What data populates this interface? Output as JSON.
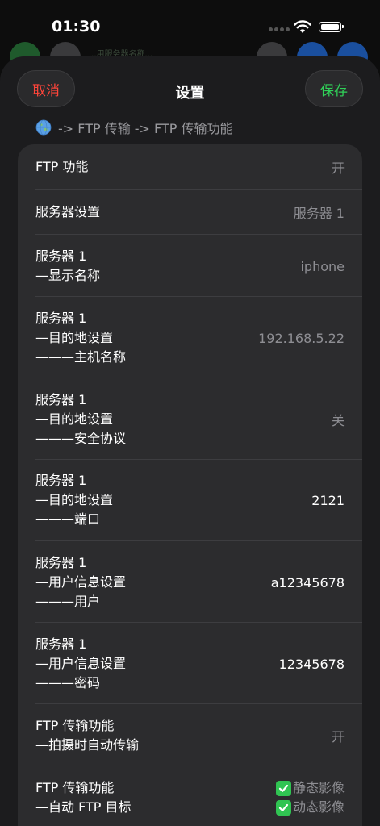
{
  "status_bar": {
    "time": "01:30"
  },
  "background_app": {
    "snippet": "...用服务器名称..."
  },
  "nav": {
    "cancel": "取消",
    "title": "设置",
    "save": "保存"
  },
  "breadcrumb": "-> FTP 传输 -> FTP 传输功能",
  "rows": [
    {
      "lines": [
        "FTP 功能"
      ],
      "value": "开",
      "value_style": "dim"
    },
    {
      "lines": [
        "服务器设置"
      ],
      "value": "服务器 1",
      "value_style": "dim"
    },
    {
      "lines": [
        "服务器 1",
        "—显示名称"
      ],
      "value": "iphone",
      "value_style": "dim"
    },
    {
      "lines": [
        "服务器 1",
        "—目的地设置",
        "———主机名称"
      ],
      "value": "192.168.5.22",
      "value_style": "dim"
    },
    {
      "lines": [
        "服务器 1",
        "—目的地设置",
        "———安全协议"
      ],
      "value": "关",
      "value_style": "dim"
    },
    {
      "lines": [
        "服务器 1",
        "—目的地设置",
        "———端口"
      ],
      "value": "2121",
      "value_style": "bright"
    },
    {
      "lines": [
        "服务器 1",
        "—用户信息设置",
        "———用户"
      ],
      "value": "a12345678",
      "value_style": "bright"
    },
    {
      "lines": [
        "服务器 1",
        "—用户信息设置",
        "———密码"
      ],
      "value": "12345678",
      "value_style": "bright"
    },
    {
      "lines": [
        "FTP 传输功能",
        "—拍摄时自动传输"
      ],
      "value": "开",
      "value_style": "dim"
    },
    {
      "lines": [
        "FTP 传输功能",
        "—自动 FTP 目标"
      ],
      "checks": [
        "静态影像",
        "动态影像"
      ]
    }
  ],
  "colors": {
    "cancel": "#ff453a",
    "save": "#30d158",
    "check": "#30c452"
  },
  "icons": {
    "breadcrumb": "globe-icon",
    "check": "checkmark-icon"
  }
}
